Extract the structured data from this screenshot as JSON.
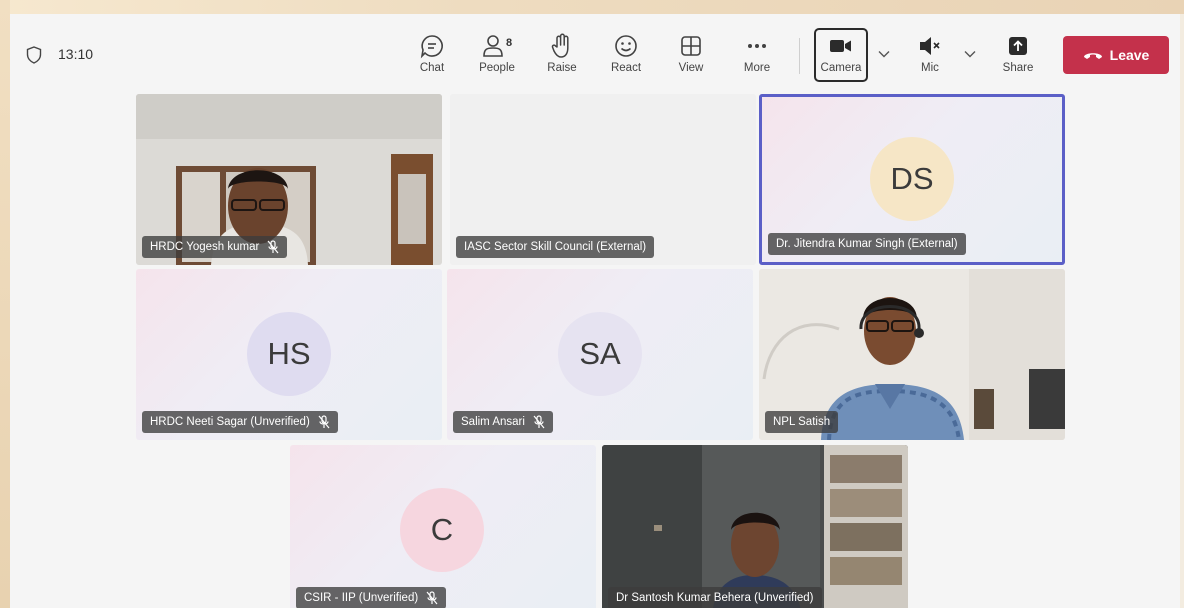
{
  "meeting": {
    "duration": "13:10"
  },
  "toolbar": {
    "chat_label": "Chat",
    "people_label": "People",
    "people_count": "8",
    "raise_label": "Raise",
    "react_label": "React",
    "view_label": "View",
    "more_label": "More",
    "camera_label": "Camera",
    "mic_label": "Mic",
    "share_label": "Share",
    "leave_label": "Leave"
  },
  "participants": [
    {
      "name": "HRDC Yogesh kumar",
      "video": true,
      "muted": true
    },
    {
      "name": "IASC Sector Skill Council (External)",
      "video": false,
      "muted": false
    },
    {
      "name": "Dr. Jitendra Kumar Singh (External)",
      "initials": "DS",
      "muted": false,
      "speaking": true
    },
    {
      "name": "HRDC Neeti Sagar (Unverified)",
      "initials": "HS",
      "muted": true
    },
    {
      "name": "Salim Ansari",
      "initials": "SA",
      "muted": true
    },
    {
      "name": "NPL Satish",
      "video": true,
      "muted": false
    },
    {
      "name": "CSIR - IIP (Unverified)",
      "initials": "C",
      "muted": true
    },
    {
      "name": "Dr Santosh Kumar Behera (Unverified)",
      "video": true,
      "muted": false
    }
  ],
  "colors": {
    "leave_button": "#c4314b",
    "active_speaker_border": "#5b5fc7",
    "avatar_ds": "#f6e6c6",
    "avatar_hs": "#dfdcf0",
    "avatar_sa": "#e6e3f1",
    "avatar_c": "#f6d6df"
  }
}
